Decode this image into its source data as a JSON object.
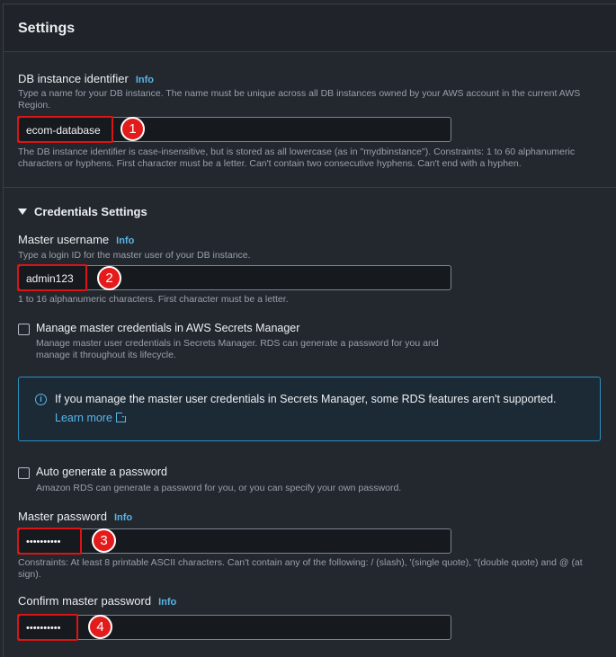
{
  "header": {
    "title": "Settings"
  },
  "db_identifier": {
    "label": "DB instance identifier",
    "info": "Info",
    "description": "Type a name for your DB instance. The name must be unique across all DB instances owned by your AWS account in the current AWS Region.",
    "value": "ecom-database",
    "constraints": "The DB instance identifier is case-insensitive, but is stored as all lowercase (as in \"mydbinstance\"). Constraints: 1 to 60 alphanumeric characters or hyphens. First character must be a letter. Can't contain two consecutive hyphens. Can't end with a hyphen."
  },
  "credentials": {
    "section_title": "Credentials Settings",
    "master_username": {
      "label": "Master username",
      "info": "Info",
      "description": "Type a login ID for the master user of your DB instance.",
      "value": "admin123",
      "constraints": "1 to 16 alphanumeric characters. First character must be a letter."
    },
    "secrets_manager": {
      "label": "Manage master credentials in AWS Secrets Manager",
      "description": "Manage master user credentials in Secrets Manager. RDS can generate a password for you and manage it throughout its lifecycle.",
      "checked": false
    },
    "alert": {
      "text": "If you manage the master user credentials in Secrets Manager, some RDS features aren't supported.",
      "link": "Learn more",
      "icon": "info-icon"
    },
    "auto_generate": {
      "label": "Auto generate a password",
      "description": "Amazon RDS can generate a password for you, or you can specify your own password.",
      "checked": false
    },
    "master_password": {
      "label": "Master password",
      "info": "Info",
      "value": "••••••••••",
      "constraints": "Constraints: At least 8 printable ASCII characters. Can't contain any of the following: / (slash), '(single quote), \"(double quote) and @ (at sign)."
    },
    "confirm_password": {
      "label": "Confirm master password",
      "info": "Info",
      "value": "••••••••••"
    }
  },
  "annotations": [
    "1",
    "2",
    "3",
    "4"
  ],
  "colors": {
    "accent": "#58b6e8",
    "highlight": "#d91515",
    "badge": "#e31b1b"
  }
}
